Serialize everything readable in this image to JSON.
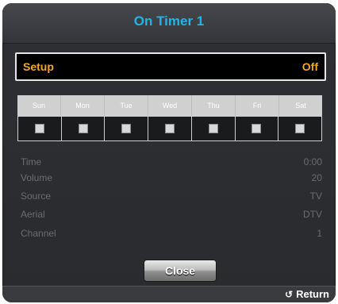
{
  "dialog": {
    "title": "On Timer 1"
  },
  "setup": {
    "label": "Setup",
    "value": "Off"
  },
  "days": [
    "Sun",
    "Mon",
    "Tue",
    "Wed",
    "Thu",
    "Fri",
    "Sat"
  ],
  "settings": [
    {
      "label": "Time",
      "value": "0:00"
    },
    {
      "label": "Volume",
      "value": "20"
    },
    {
      "label": "Source",
      "value": "TV"
    },
    {
      "label": "Aerial",
      "value": "DTV"
    },
    {
      "label": "Channel",
      "value": "1"
    }
  ],
  "buttons": {
    "close": "Close"
  },
  "footer": {
    "return_label": "Return",
    "return_icon": "↺"
  },
  "colors": {
    "title": "#1fb7e8",
    "highlight": "#f3a62a"
  }
}
